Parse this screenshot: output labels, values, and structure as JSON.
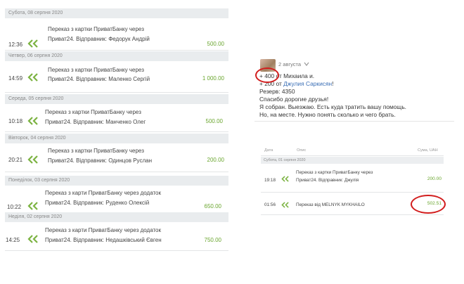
{
  "left_list": [
    {
      "date": "Субота, 08 серпня 2020",
      "time": "12:36",
      "line1": "Переказ з картки ПриватБанку через",
      "line2": "Приват24. Відправник: Федорук Андрій",
      "amount": "500.00"
    },
    {
      "date": "Четвер, 06 серпня 2020",
      "time": "14:59",
      "line1": "Переказ з картки ПриватБанку через",
      "line2": "Приват24. Відправник: Маленко Сергій",
      "amount": "1 000.00"
    },
    {
      "date": "Середа, 05 серпня 2020",
      "time": "10:18",
      "line1": "Переказ з картки ПриватБанку через",
      "line2": "Приват24. Відправник: Манченко Олег",
      "amount": "500.00"
    },
    {
      "date": "Вівторок, 04 серпня 2020",
      "time": "20:21",
      "line1": "Переказ з картки ПриватБанку через",
      "line2": "Приват24. Відправник: Одинцов Руслан",
      "amount": "200.00"
    },
    {
      "date": "Понеділок, 03 серпня 2020",
      "time": "10:22",
      "line1": "Переказ з карти ПриватБанку через додаток",
      "line2": "Приват24. Відправник: Руденко Олексій",
      "amount": "650.00"
    },
    {
      "date": "Неділя, 02 серпня 2020",
      "time": "14:25",
      "line1": "Переказ з карти ПриватБанку через додаток",
      "line2": "Приват24. Відправник: Недашківський Євген",
      "amount": "750.00"
    }
  ],
  "post": {
    "date": "2 августа",
    "l1a": "+ 400",
    "l1b": " от Михаила и.",
    "l2a": "+ 200 от ",
    "l2b": "Джулия Саркисян",
    "l2c": "!",
    "l3": "Резерв: 4350",
    "l4": "Спасибо дорогие друзья!",
    "l5": "Я собран. Выезжаю. Есть куда тратить вашу помощь.",
    "l6": "Но, на месте. Нужно понять сколько и чего брать."
  },
  "mini_table": {
    "headers": {
      "date": "Дата",
      "desc": "Опис",
      "amount": "Сума, UAH"
    },
    "day": "Субота, 01 серпня 2020",
    "rows": [
      {
        "time": "19:18",
        "line1": "Переказ з картки ПриватБанку через",
        "line2": "Приват24. Відправник: Джулія",
        "amount": "200.00"
      },
      {
        "time": "01:56",
        "line1": "Переказ від MELNYK MYKHAILO",
        "amount": "502.51"
      }
    ]
  },
  "colors": {
    "green": "#6aa62f",
    "link": "#3b6fb6",
    "highlight": "#d21e1e",
    "header_bg": "#e9ecee"
  }
}
